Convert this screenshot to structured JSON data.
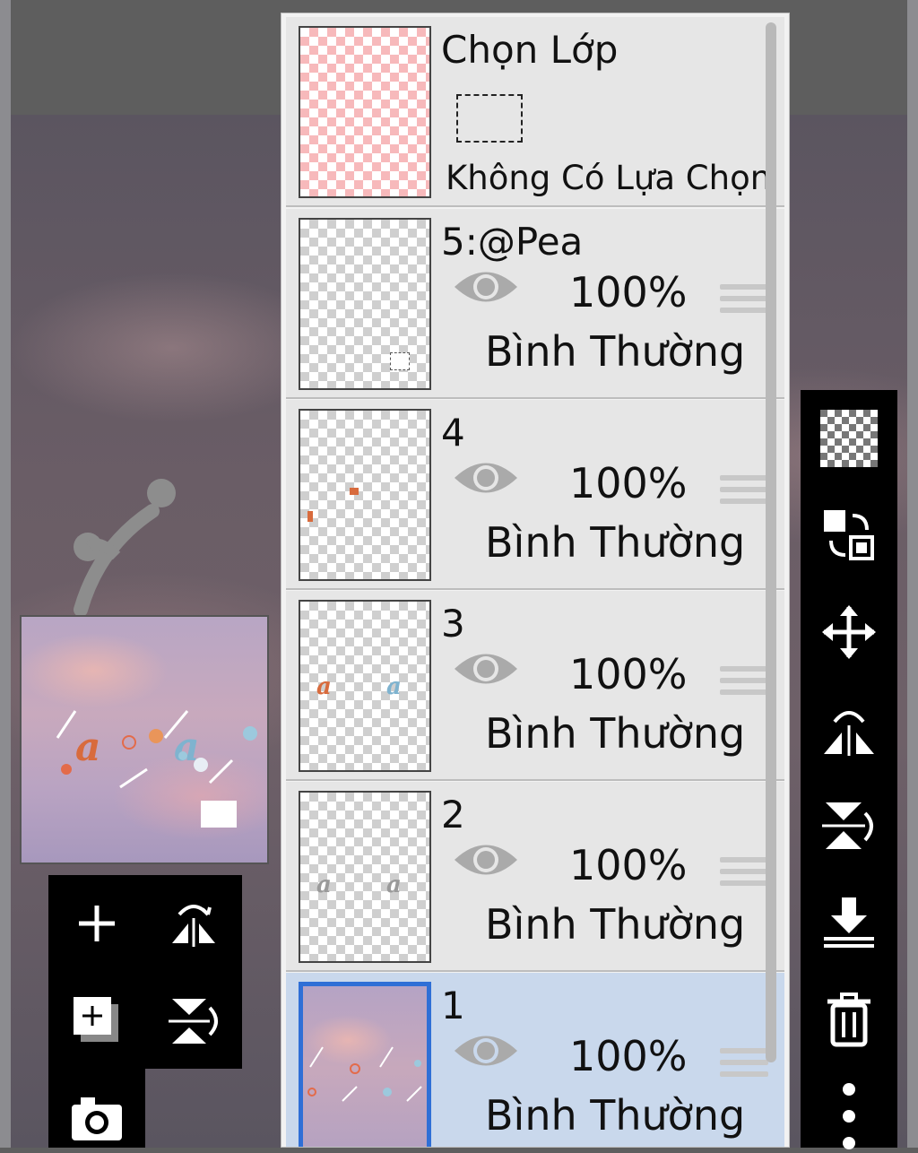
{
  "panel": {
    "selection_layer": {
      "title": "Chọn Lớp",
      "status": "Không Có Lựa Chọn"
    },
    "layers": [
      {
        "name": "5:@Pea",
        "opacity": "100%",
        "blend_mode": "Bình Thường",
        "visible": true,
        "selected": false
      },
      {
        "name": "4",
        "opacity": "100%",
        "blend_mode": "Bình Thường",
        "visible": true,
        "selected": false
      },
      {
        "name": "3",
        "opacity": "100%",
        "blend_mode": "Bình Thường",
        "visible": true,
        "selected": false
      },
      {
        "name": "2",
        "opacity": "100%",
        "blend_mode": "Bình Thường",
        "visible": true,
        "selected": false
      },
      {
        "name": "1",
        "opacity": "100%",
        "blend_mode": "Bình Thường",
        "visible": true,
        "selected": true
      }
    ]
  },
  "left_toolbar": {
    "icons": [
      "plus-icon",
      "flip-horizontal-icon",
      "add-layer-icon",
      "flip-vertical-icon",
      "camera-icon"
    ]
  },
  "right_toolbar": {
    "icons": [
      "transparency-icon",
      "swap-layers-icon",
      "move-icon",
      "flip-horizontal-icon",
      "flip-vertical-icon",
      "merge-down-icon",
      "trash-icon",
      "more-icon"
    ]
  },
  "colors": {
    "selected_layer_bg": "#c9d8ec",
    "selected_border": "#2f6fd6",
    "toolbar_bg": "#000000"
  }
}
